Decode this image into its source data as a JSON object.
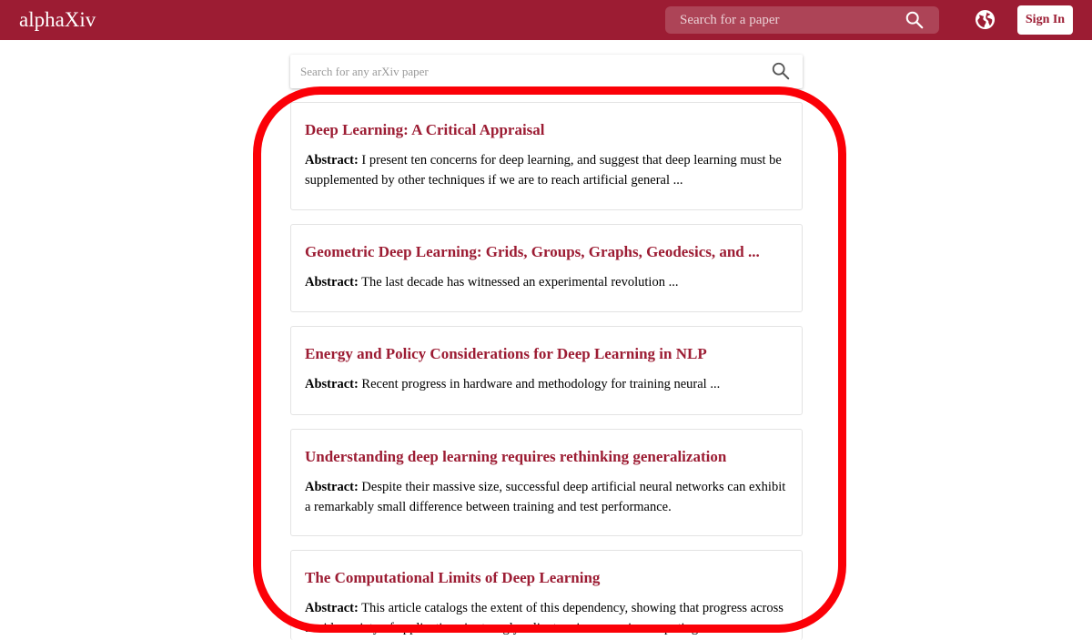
{
  "header": {
    "brand": "alphaXiv",
    "search_placeholder": "Search for a paper",
    "sign_in_label": "Sign In"
  },
  "main_search": {
    "placeholder": "Search for any arXiv paper"
  },
  "abstract_label": "Abstract:",
  "papers": [
    {
      "title": "Deep Learning: A Critical Appraisal",
      "abstract": "I present ten concerns for deep learning, and suggest that deep learning must be supplemented by other techniques if we are to reach artificial general ..."
    },
    {
      "title": "Geometric Deep Learning: Grids, Groups, Graphs, Geodesics, and ...",
      "abstract": "The last decade has witnessed an experimental revolution ..."
    },
    {
      "title": "Energy and Policy Considerations for Deep Learning in NLP",
      "abstract": "Recent progress in hardware and methodology for training neural ..."
    },
    {
      "title": "Understanding deep learning requires rethinking generalization",
      "abstract": "Despite their massive size, successful deep artificial neural networks can exhibit a remarkably small difference between training and test performance."
    },
    {
      "title": "The Computational Limits of Deep Learning",
      "abstract": "This article catalogs the extent of this dependency, showing that progress across a wide variety of applications is strongly reliant on increases in computing ..."
    }
  ],
  "colors": {
    "brand": "#9c1c33",
    "highlight": "#fb0007"
  },
  "icons": [
    "search-icon",
    "globe-icon"
  ]
}
